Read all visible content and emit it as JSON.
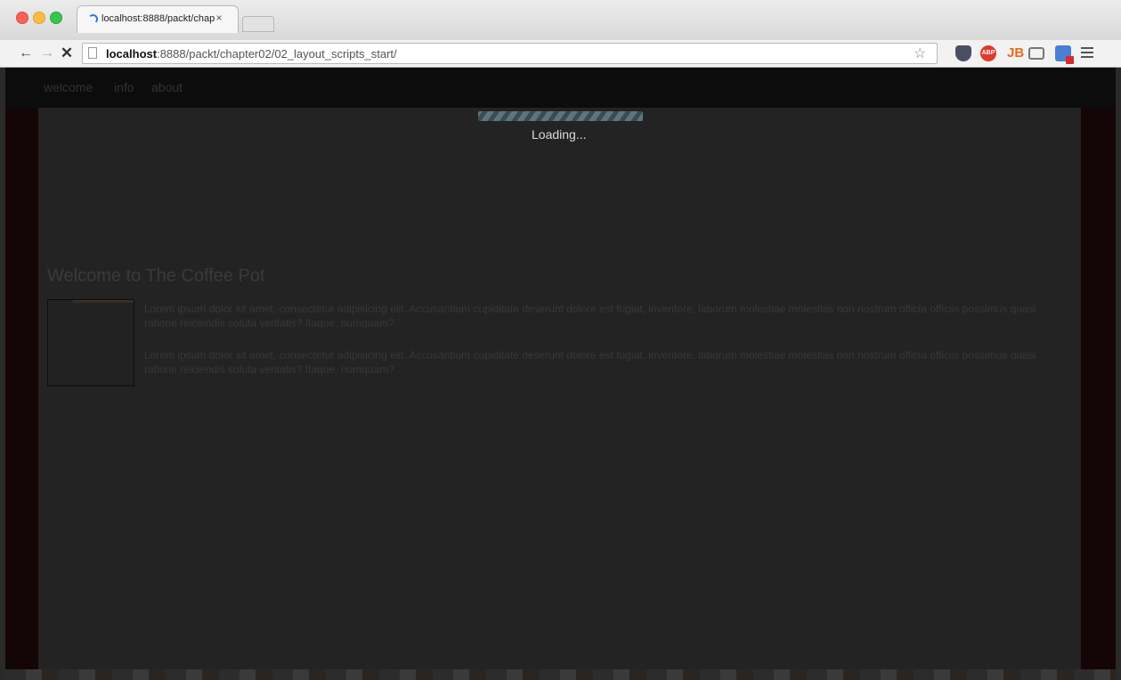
{
  "browser": {
    "tab": {
      "title": "localhost:8888/packt/chap",
      "close_glyph": "×"
    },
    "nav": {
      "back_glyph": "←",
      "forward_glyph": "→",
      "stop_glyph": "✕"
    },
    "omnibox": {
      "host": "localhost",
      "path": ":8888/packt/chapter02/02_layout_scripts_start/",
      "star_glyph": "☆"
    },
    "extensions": {
      "abp_label": "ABP",
      "jb_label": "JB",
      "icons": [
        "pocket-icon",
        "adblock-plus-icon",
        "jetbrains-icon",
        "cast-icon",
        "blue-extension-icon",
        "menu-icon"
      ]
    }
  },
  "site": {
    "nav_items": [
      "welcome",
      "info",
      "about"
    ],
    "loading": {
      "text": "Loading...",
      "progress": 1.0
    },
    "heading": "Welcome to The Coffee Pot",
    "paragraphs": [
      "Lorem ipsum dolor sit amet, consectetur adipisicing elit. Accusantium cupiditate deserunt dolore est fugiat, inventore, laborum molestiae molestias non nostrum officia officiis possimus quasi ratione reiciendis soluta veritatis? Itaque, numquam?",
      "Lorem ipsum dolor sit amet, consectetur adipisicing elit. Accusantium cupiditate deserunt dolore est fugiat, inventore, laborum molestiae molestias non nostrum officia officiis possimus quasi ratione reiciendis soluta veritatis? Itaque, numquam?"
    ]
  },
  "colors": {
    "page_bg": "#140606",
    "main_bg": "#232323",
    "progress_stripe": "#5c7580",
    "loading_text": "#dcdcdc"
  }
}
